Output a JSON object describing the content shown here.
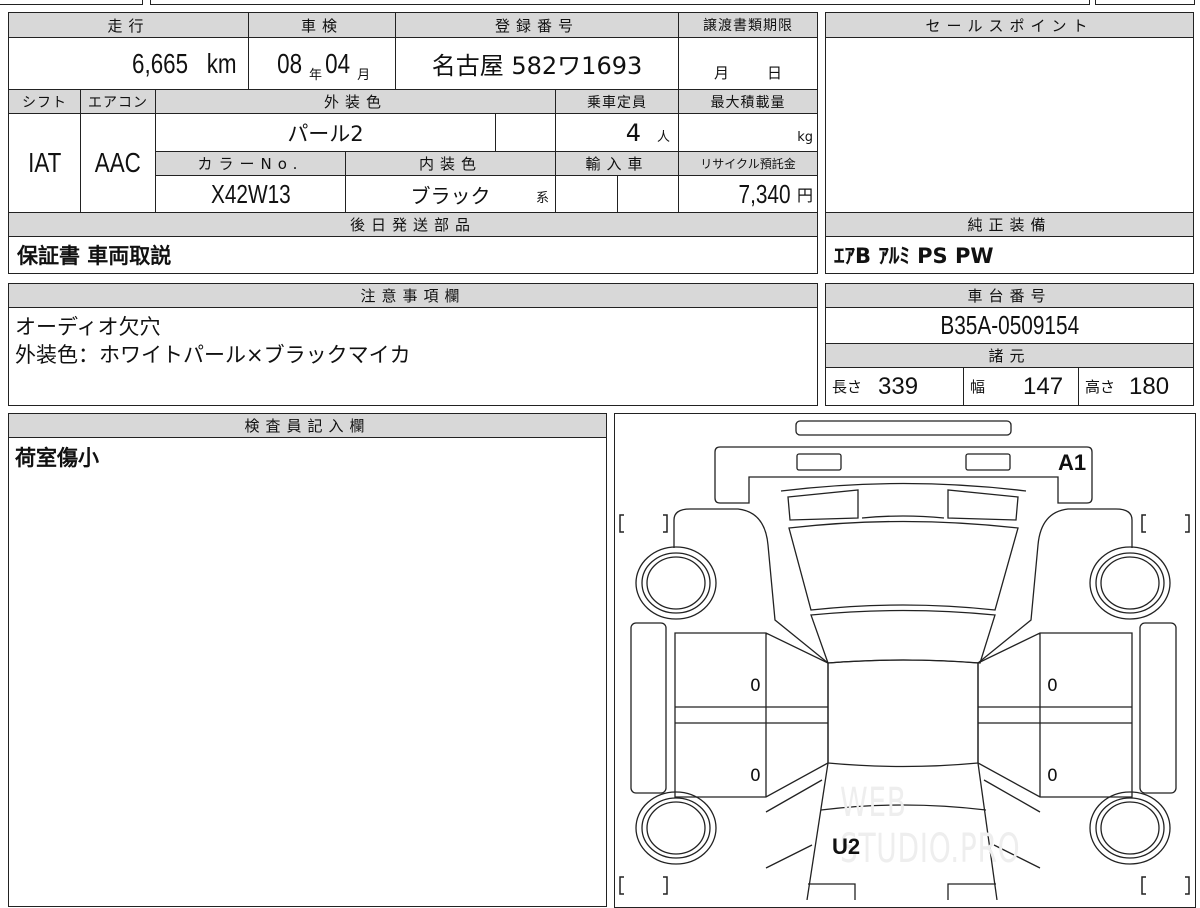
{
  "mileage": {
    "label": "走行",
    "value": "6,665",
    "unit": "km"
  },
  "inspection": {
    "label": "車検",
    "year": "08",
    "year_unit": "年",
    "month": "04",
    "month_unit": "月"
  },
  "registration": {
    "label": "登録番号",
    "value": "名古屋 582ワ1693"
  },
  "transfer_deadline": {
    "label": "譲渡書類期限",
    "month_unit": "月",
    "day_unit": "日"
  },
  "shift": {
    "label": "シフト",
    "value": "IAT"
  },
  "aircon": {
    "label": "エアコン",
    "value": "AAC"
  },
  "exterior_color": {
    "label": "外装色",
    "value": "パール2"
  },
  "capacity": {
    "label": "乗車定員",
    "value": "4",
    "unit": "人"
  },
  "max_load": {
    "label": "最大積載量",
    "unit": "kg"
  },
  "color_no": {
    "label": "カラーNo.",
    "value": "X42W13"
  },
  "interior_color": {
    "label": "内装色",
    "value": "ブラック",
    "suffix": "系"
  },
  "import": {
    "label": "輸入車"
  },
  "recycle": {
    "label": "リサイクル預託金",
    "value": "7,340",
    "unit": "円"
  },
  "later_parts": {
    "label": "後日発送部品",
    "value": "保証書 車両取説"
  },
  "sales_point": {
    "label": "セールスポイント"
  },
  "equipment": {
    "label": "純正装備",
    "value": "ｴｱB ｱﾙﾐ PS PW"
  },
  "notes": {
    "label": "注意事項欄",
    "lines": [
      "オーディオ欠穴",
      "外装色：ホワイトパール×ブラックマイカ"
    ]
  },
  "chassis": {
    "label": "車台番号",
    "value": "B35A-0509154"
  },
  "specs": {
    "label": "諸元",
    "length_label": "長さ",
    "length": "339",
    "width_label": "幅",
    "width": "147",
    "height_label": "高さ",
    "height": "180"
  },
  "inspector": {
    "label": "検査員記入欄",
    "value": "荷室傷小"
  },
  "diagram": {
    "marks": {
      "front": "A1",
      "rear": "U2",
      "door_fl": "0",
      "door_rl": "0",
      "door_fr": "0",
      "door_rr": "0"
    },
    "watermark": "WEB STUDIO.PRO"
  }
}
